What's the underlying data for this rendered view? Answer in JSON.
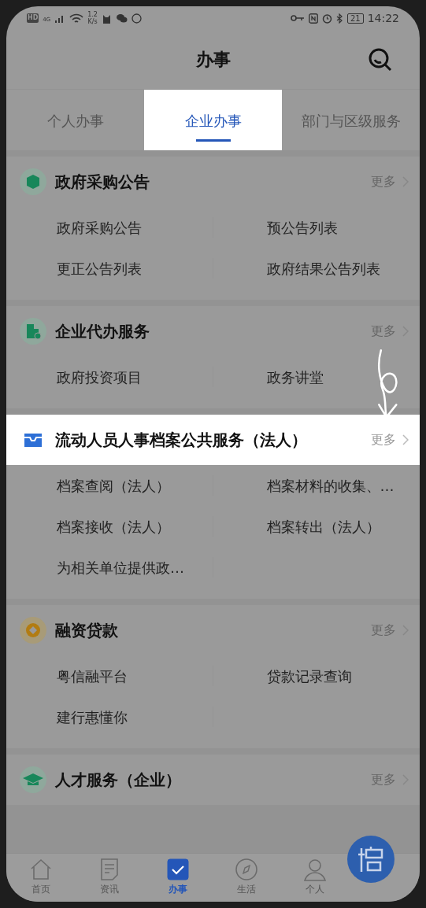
{
  "status_bar": {
    "hd": "HD",
    "network": "4G",
    "speed_value": "1.2",
    "speed_unit": "K/s",
    "battery": "21",
    "time": "14:22"
  },
  "title": "办事",
  "tabs": [
    {
      "label": "个人办事",
      "selected": false,
      "highlighted": false
    },
    {
      "label": "企业办事",
      "selected": true,
      "highlighted": true
    },
    {
      "label": "部门与区级服务",
      "selected": false,
      "highlighted": false
    }
  ],
  "sections": [
    {
      "kind": "box",
      "title": "政府采购公告",
      "more": "更多",
      "highlighted": false,
      "items": [
        "政府采购公告",
        "预公告列表",
        "更正公告列表",
        "政府结果公告列表"
      ]
    },
    {
      "kind": "building",
      "title": "企业代办服务",
      "more": "更多",
      "highlighted": false,
      "items": [
        "政府投资项目",
        "政务讲堂"
      ]
    },
    {
      "kind": "folder",
      "title": "流动人员人事档案公共服务（法人）",
      "more": "更多",
      "highlighted": true,
      "items": [
        "档案查阅（法人）",
        "档案材料的收集、…",
        "档案接收（法人）",
        "档案转出（法人）",
        "为相关单位提供政…"
      ]
    },
    {
      "kind": "coin",
      "title": "融资贷款",
      "more": "更多",
      "highlighted": false,
      "items": [
        "粤信融平台",
        "贷款记录查询",
        "建行惠懂你"
      ]
    },
    {
      "kind": "cap",
      "title": "人才服务（企业）",
      "more": "更多",
      "highlighted": false
    }
  ],
  "nav": [
    {
      "kind": "home",
      "label": "首页",
      "selected": false
    },
    {
      "kind": "news",
      "label": "资讯",
      "selected": false
    },
    {
      "kind": "tasks",
      "label": "办事",
      "selected": true
    },
    {
      "kind": "compass",
      "label": "生活",
      "selected": false
    },
    {
      "kind": "person",
      "label": "个人",
      "selected": false
    }
  ]
}
